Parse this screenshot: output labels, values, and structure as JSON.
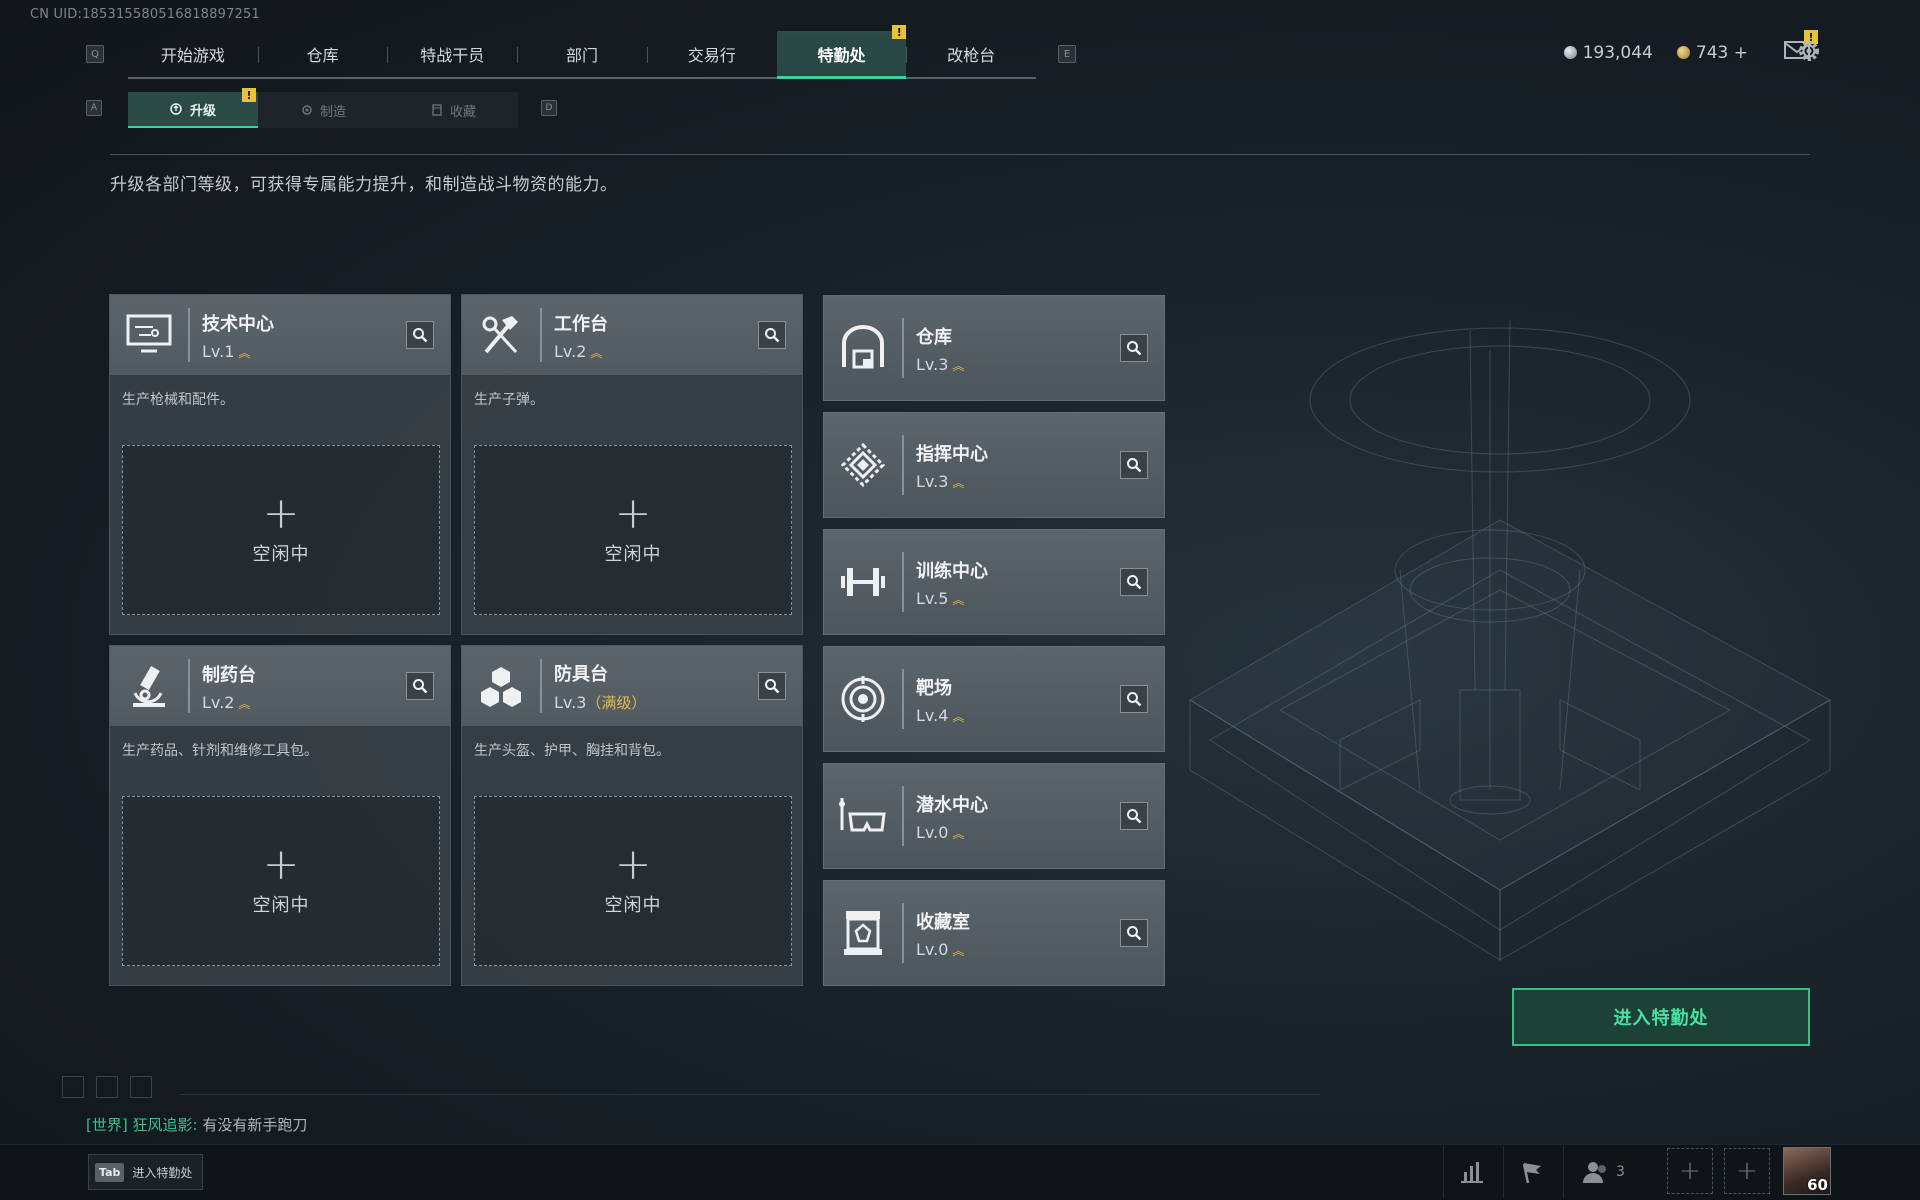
{
  "uid": "CN UID:18531558051681​8897251",
  "main_tabs": {
    "left_key": "Q",
    "right_key": "E",
    "items": [
      "开始游戏",
      "仓库",
      "特战干员",
      "部门",
      "交易行",
      "特勤处",
      "改枪台"
    ],
    "active_index": 5,
    "badge": "!"
  },
  "currency": {
    "silver": "193,044",
    "gold": "743 +"
  },
  "mail_badge": "!",
  "sub_tabs": {
    "left_key": "A",
    "right_key": "D",
    "items": [
      "升级",
      "制造",
      "收藏"
    ],
    "active_index": 0,
    "badge": "!"
  },
  "description": "升级各部门等级，可获得专属能力提升，和制造战斗物资的能力。",
  "big_cards": [
    {
      "title": "技术中心",
      "level": "Lv.1",
      "max": "",
      "desc": "生产枪械和配件。",
      "slot_label": "空闲中",
      "icon": "computer-icon"
    },
    {
      "title": "工作台",
      "level": "Lv.2",
      "max": "",
      "desc": "生产子弹。",
      "slot_label": "空闲中",
      "icon": "tools-icon"
    },
    {
      "title": "制药台",
      "level": "Lv.2",
      "max": "",
      "desc": "生产药品、针剂和维修工具包。",
      "slot_label": "空闲中",
      "icon": "microscope-icon"
    },
    {
      "title": "防具台",
      "level": "Lv.3",
      "max": "（满级）",
      "desc": "生产头盔、护甲、胸挂和背包。",
      "slot_label": "空闲中",
      "icon": "boxes-icon"
    }
  ],
  "small_cards": [
    {
      "title": "仓库",
      "level": "Lv.3",
      "icon": "warehouse-icon"
    },
    {
      "title": "指挥中心",
      "level": "Lv.3",
      "icon": "command-icon"
    },
    {
      "title": "训练中心",
      "level": "Lv.5",
      "icon": "dumbbell-icon"
    },
    {
      "title": "靶场",
      "level": "Lv.4",
      "icon": "target-icon"
    },
    {
      "title": "潜水中心",
      "level": "Lv.0",
      "icon": "diving-mask-icon"
    },
    {
      "title": "收藏室",
      "level": "Lv.0",
      "icon": "trophy-case-icon"
    }
  ],
  "enter_button": "进入特勤处",
  "chat": {
    "channel": "[世界]",
    "sender": "狂风追影:",
    "message": "有没有新手跑刀"
  },
  "tab_hint": {
    "key": "Tab",
    "label": "进入特勤处"
  },
  "friends_count": "3",
  "player_level": "60",
  "colors": {
    "accent": "#3fcf9a",
    "level_arrow": "#e0b94a",
    "badge": "#e8c33a"
  }
}
